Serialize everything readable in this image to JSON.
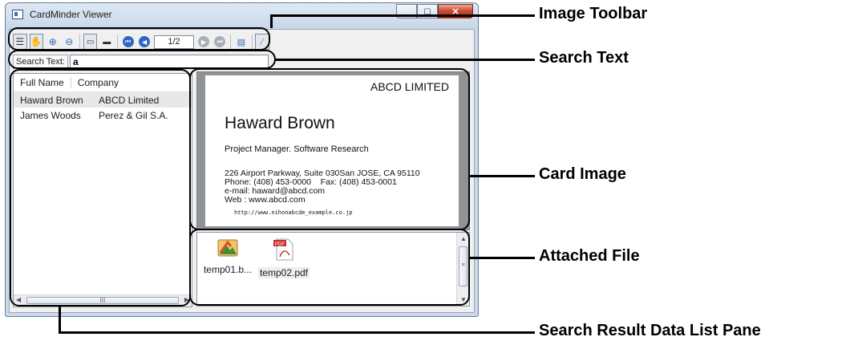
{
  "window": {
    "title": "CardMinder Viewer"
  },
  "toolbar": {
    "page_indicator": "1/2"
  },
  "search": {
    "label": "Search Text:",
    "value": "a"
  },
  "list": {
    "columns": [
      "Full Name",
      "Company"
    ],
    "rows": [
      {
        "name": "Haward Brown",
        "company": "ABCD Limited",
        "selected": true
      },
      {
        "name": "James Woods",
        "company": "Perez & Gil S.A.",
        "selected": false
      }
    ],
    "scroll_thumb": "III"
  },
  "card": {
    "company": "ABCD LIMITED",
    "name": "Haward Brown",
    "title": "Project Manager. Software Research",
    "address": "226 Airport Parkway, Suite 030San JOSE, CA 95110",
    "phone": "Phone: (408) 453-0000",
    "fax": "Fax: (408) 453-0001",
    "email": "e-mail: haward@abcd.com",
    "web": "Web  : www.abcd.com",
    "url": "http://www.nihonabcde_example.co.jp"
  },
  "attachments": [
    {
      "name": "temp01.b...",
      "icon": "image-file-icon"
    },
    {
      "name": "temp02.pdf",
      "icon": "pdf-file-icon"
    }
  ],
  "callouts": {
    "image_toolbar": "Image Toolbar",
    "search_text": "Search Text",
    "card_image": "Card Image",
    "attached_file": "Attached File",
    "result_list": "Search Result Data List Pane"
  }
}
